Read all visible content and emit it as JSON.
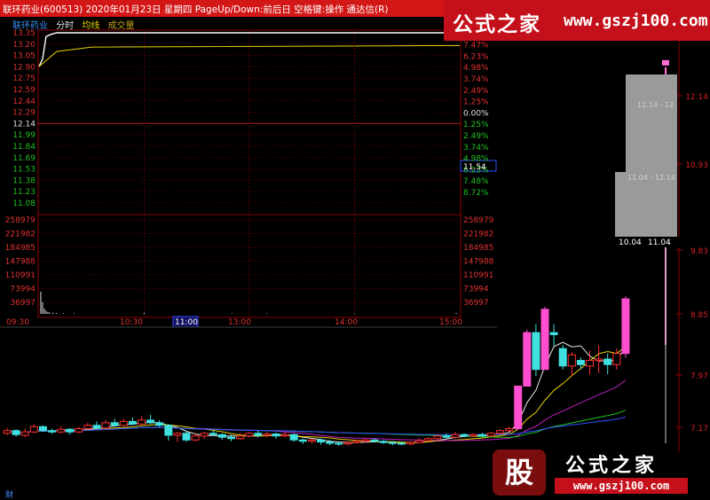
{
  "title_bar": {
    "text": "联环药业(600513)  2020年01月23日  星期四  PageUp/Down:前后日  空格键:操作  通达信(R)"
  },
  "brand_watermark": {
    "name": "公式之家",
    "url": "www.gszj100.com"
  },
  "bottom_watermark": {
    "logo_char": "股",
    "name": "公式之家",
    "url": "www.gszj100.com"
  },
  "bottom_glyph": "财",
  "intraday": {
    "tabs": {
      "stock": "联环药业",
      "fenshi": "分时",
      "avg": "均线",
      "vol": "成交量"
    },
    "price_ticks": [
      "13.35",
      "13.20",
      "13.05",
      "12.90",
      "12.75",
      "12.59",
      "12.44",
      "12.29",
      "12.14",
      "11.99",
      "11.84",
      "11.69",
      "11.53",
      "11.38",
      "11.23",
      "11.08"
    ],
    "pct_ticks": [
      "8.72%",
      "7.47%",
      "6.23%",
      "4.98%",
      "3.74%",
      "2.49%",
      "1.25%",
      "0.00%",
      "1.25%",
      "2.49%",
      "3.74%",
      "4.98%",
      "6.23%",
      "7.48%",
      "8.72%"
    ],
    "vol_ticks": [
      "258979",
      "221982",
      "184985",
      "147988",
      "110991",
      "73994",
      "36997"
    ],
    "time_ticks": [
      "09:30",
      "10:30",
      "11:00",
      "13:00",
      "14:00",
      "15:00"
    ],
    "cursor_price": "11.54",
    "prev_close": 12.14,
    "price_path": [
      {
        "t": 0,
        "p": 12.9
      },
      {
        "t": 2,
        "p": 13.0
      },
      {
        "t": 4,
        "p": 13.3
      },
      {
        "t": 7,
        "p": 13.33
      },
      {
        "t": 10,
        "p": 13.35
      },
      {
        "t": 240,
        "p": 13.35
      }
    ],
    "avg_path": [
      {
        "t": 0,
        "p": 12.9
      },
      {
        "t": 10,
        "p": 13.1
      },
      {
        "t": 30,
        "p": 13.16
      },
      {
        "t": 240,
        "p": 13.18
      }
    ],
    "volume_bars": [
      {
        "t": 1,
        "v": 60000
      },
      {
        "t": 2,
        "v": 32000
      },
      {
        "t": 3,
        "v": 14000
      },
      {
        "t": 4,
        "v": 8000
      },
      {
        "t": 5,
        "v": 5000
      },
      {
        "t": 6,
        "v": 4000
      },
      {
        "t": 8,
        "v": 3000
      },
      {
        "t": 10,
        "v": 2500
      },
      {
        "t": 14,
        "v": 2000
      },
      {
        "t": 20,
        "v": 1500
      },
      {
        "t": 60,
        "v": 3000
      },
      {
        "t": 110,
        "v": 1500
      },
      {
        "t": 130,
        "v": 1200
      },
      {
        "t": 180,
        "v": 1200
      },
      {
        "t": 238,
        "v": 2500
      }
    ]
  },
  "main_chart": {
    "price_axis": [
      "12.14",
      "10.93",
      "9.83",
      "8.85",
      "7.97",
      "7.17"
    ],
    "tooltip": {
      "upper": "12.14 - 12",
      "lower": "11.04 - 12.14",
      "bottom_left": "10.04",
      "bottom_right": "11.04"
    }
  },
  "chart_data": {
    "type": "candlestick",
    "price_ticks": [
      12.14,
      10.93,
      9.83,
      8.85,
      7.97,
      7.17
    ],
    "candles": [
      {
        "o": 7.08,
        "c": 7.12,
        "h": 7.16,
        "l": 7.05
      },
      {
        "o": 7.12,
        "c": 7.06,
        "h": 7.14,
        "l": 7.03
      },
      {
        "o": 7.05,
        "c": 7.1,
        "h": 7.15,
        "l": 7.02
      },
      {
        "o": 7.1,
        "c": 7.18,
        "h": 7.22,
        "l": 7.08
      },
      {
        "o": 7.18,
        "c": 7.12,
        "h": 7.2,
        "l": 7.1
      },
      {
        "o": 7.12,
        "c": 7.1,
        "h": 7.15,
        "l": 7.07
      },
      {
        "o": 7.1,
        "c": 7.14,
        "h": 7.18,
        "l": 7.08
      },
      {
        "o": 7.14,
        "c": 7.1,
        "h": 7.16,
        "l": 7.06
      },
      {
        "o": 7.1,
        "c": 7.15,
        "h": 7.18,
        "l": 7.08
      },
      {
        "o": 7.15,
        "c": 7.2,
        "h": 7.24,
        "l": 7.12
      },
      {
        "o": 7.2,
        "c": 7.16,
        "h": 7.26,
        "l": 7.14
      },
      {
        "o": 7.16,
        "c": 7.24,
        "h": 7.28,
        "l": 7.14
      },
      {
        "o": 7.24,
        "c": 7.2,
        "h": 7.3,
        "l": 7.18
      },
      {
        "o": 7.2,
        "c": 7.26,
        "h": 7.3,
        "l": 7.18
      },
      {
        "o": 7.26,
        "c": 7.22,
        "h": 7.32,
        "l": 7.2
      },
      {
        "o": 7.22,
        "c": 7.28,
        "h": 7.34,
        "l": 7.2
      },
      {
        "o": 7.28,
        "c": 7.24,
        "h": 7.36,
        "l": 7.22
      },
      {
        "o": 7.24,
        "c": 7.2,
        "h": 7.28,
        "l": 7.18
      },
      {
        "o": 7.2,
        "c": 7.05,
        "h": 7.22,
        "l": 6.97
      },
      {
        "o": 7.05,
        "c": 7.08,
        "h": 7.1,
        "l": 6.95
      },
      {
        "o": 7.08,
        "c": 6.98,
        "h": 7.12,
        "l": 6.95
      },
      {
        "o": 6.98,
        "c": 7.04,
        "h": 7.08,
        "l": 6.96
      },
      {
        "o": 7.04,
        "c": 7.08,
        "h": 7.1,
        "l": 7.0
      },
      {
        "o": 7.08,
        "c": 7.06,
        "h": 7.12,
        "l": 7.04
      },
      {
        "o": 7.06,
        "c": 7.02,
        "h": 7.08,
        "l": 6.98
      },
      {
        "o": 7.02,
        "c": 7.0,
        "h": 7.06,
        "l": 6.96
      },
      {
        "o": 7.0,
        "c": 7.04,
        "h": 7.08,
        "l": 6.98
      },
      {
        "o": 7.04,
        "c": 7.08,
        "h": 7.1,
        "l": 7.02
      },
      {
        "o": 7.08,
        "c": 7.05,
        "h": 7.12,
        "l": 7.02
      },
      {
        "o": 7.05,
        "c": 7.07,
        "h": 7.1,
        "l": 7.02
      },
      {
        "o": 7.07,
        "c": 7.04,
        "h": 7.09,
        "l": 7.0
      },
      {
        "o": 7.04,
        "c": 7.06,
        "h": 7.1,
        "l": 7.02
      },
      {
        "o": 7.06,
        "c": 6.98,
        "h": 7.08,
        "l": 6.95
      },
      {
        "o": 6.98,
        "c": 6.96,
        "h": 7.0,
        "l": 6.92
      },
      {
        "o": 6.96,
        "c": 6.98,
        "h": 7.0,
        "l": 6.93
      },
      {
        "o": 6.98,
        "c": 6.95,
        "h": 7.0,
        "l": 6.91
      },
      {
        "o": 6.95,
        "c": 6.93,
        "h": 6.98,
        "l": 6.9
      },
      {
        "o": 6.93,
        "c": 6.92,
        "h": 6.96,
        "l": 6.89
      },
      {
        "o": 6.92,
        "c": 6.94,
        "h": 6.96,
        "l": 6.9
      },
      {
        "o": 6.94,
        "c": 6.96,
        "h": 6.98,
        "l": 6.92
      },
      {
        "o": 6.96,
        "c": 6.98,
        "h": 7.0,
        "l": 6.94
      },
      {
        "o": 6.98,
        "c": 6.96,
        "h": 7.0,
        "l": 6.94
      },
      {
        "o": 6.96,
        "c": 6.94,
        "h": 6.98,
        "l": 6.92
      },
      {
        "o": 6.94,
        "c": 6.93,
        "h": 6.96,
        "l": 6.9
      },
      {
        "o": 6.93,
        "c": 6.92,
        "h": 6.95,
        "l": 6.9
      },
      {
        "o": 6.92,
        "c": 6.94,
        "h": 6.96,
        "l": 6.9
      },
      {
        "o": 6.94,
        "c": 6.97,
        "h": 7.0,
        "l": 6.93
      },
      {
        "o": 6.97,
        "c": 7.0,
        "h": 7.02,
        "l": 6.95
      },
      {
        "o": 7.0,
        "c": 7.04,
        "h": 7.06,
        "l": 6.98
      },
      {
        "o": 7.04,
        "c": 7.02,
        "h": 7.08,
        "l": 7.0
      },
      {
        "o": 7.02,
        "c": 7.06,
        "h": 7.1,
        "l": 7.0
      },
      {
        "o": 7.06,
        "c": 7.04,
        "h": 7.08,
        "l": 7.02
      },
      {
        "o": 7.04,
        "c": 7.06,
        "h": 7.08,
        "l": 7.02
      },
      {
        "o": 7.06,
        "c": 7.04,
        "h": 7.09,
        "l": 7.02
      },
      {
        "o": 7.04,
        "c": 7.08,
        "h": 7.1,
        "l": 7.02
      },
      {
        "o": 7.08,
        "c": 7.12,
        "h": 7.14,
        "l": 7.06
      },
      {
        "o": 7.12,
        "c": 7.15,
        "h": 7.18,
        "l": 7.1
      },
      {
        "o": 7.15,
        "c": 7.8,
        "h": 7.8,
        "l": 7.13
      },
      {
        "o": 7.8,
        "c": 8.58,
        "h": 8.62,
        "l": 7.8
      },
      {
        "o": 8.58,
        "c": 8.05,
        "h": 8.7,
        "l": 7.95
      },
      {
        "o": 8.05,
        "c": 8.92,
        "h": 8.96,
        "l": 8.05
      },
      {
        "o": 8.58,
        "c": 8.55,
        "h": 8.7,
        "l": 8.38
      },
      {
        "o": 8.35,
        "c": 8.1,
        "h": 8.4,
        "l": 8.05
      },
      {
        "o": 8.1,
        "c": 8.26,
        "h": 8.3,
        "l": 7.95
      },
      {
        "o": 8.18,
        "c": 8.12,
        "h": 8.22,
        "l": 8.05
      },
      {
        "o": 8.1,
        "c": 8.18,
        "h": 8.32,
        "l": 7.98
      },
      {
        "o": 8.18,
        "c": 8.2,
        "h": 8.4,
        "l": 8.0
      },
      {
        "o": 8.2,
        "c": 8.12,
        "h": 8.28,
        "l": 7.98
      },
      {
        "o": 8.12,
        "c": 8.28,
        "h": 8.35,
        "l": 8.05
      },
      {
        "o": 8.28,
        "c": 9.08,
        "h": 9.12,
        "l": 8.22
      }
    ],
    "last_spike": {
      "low": 8.4,
      "high": 12.6
    }
  }
}
